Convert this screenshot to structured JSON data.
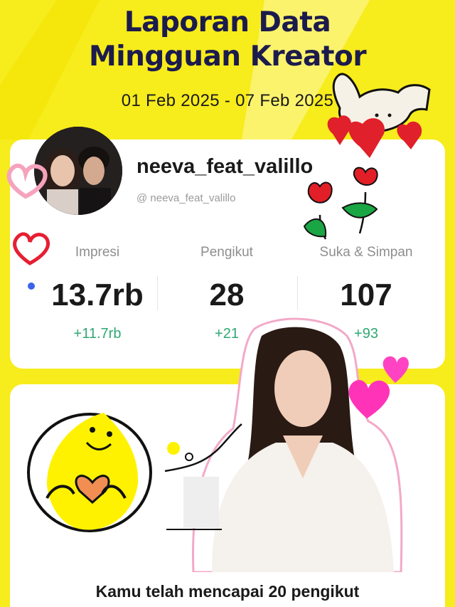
{
  "header": {
    "title_line1": "Laporan Data",
    "title_line2": "Mingguan Kreator",
    "date_range": "01 Feb 2025 - 07 Feb 2025"
  },
  "profile": {
    "username": "neeva_feat_valillo",
    "handle": "@ neeva_feat_valillo"
  },
  "stats": [
    {
      "label": "Impresi",
      "value": "13.7rb",
      "delta": "+11.7rb"
    },
    {
      "label": "Pengikut",
      "value": "28",
      "delta": "+21"
    },
    {
      "label": "Suka & Simpan",
      "value": "107",
      "delta": "+93"
    }
  ],
  "milestone": {
    "text": "Kamu telah mencapai 20 pengikut"
  },
  "colors": {
    "background": "#f7ec1c",
    "title": "#1c1b4d",
    "positive_delta": "#2fa873",
    "card": "#ffffff"
  },
  "icons": [
    "heart-outline-icon",
    "bunny-with-hearts-icon",
    "tulip-flowers-icon",
    "smiley-lemon-heart-icon",
    "pink-hearts-icon"
  ]
}
